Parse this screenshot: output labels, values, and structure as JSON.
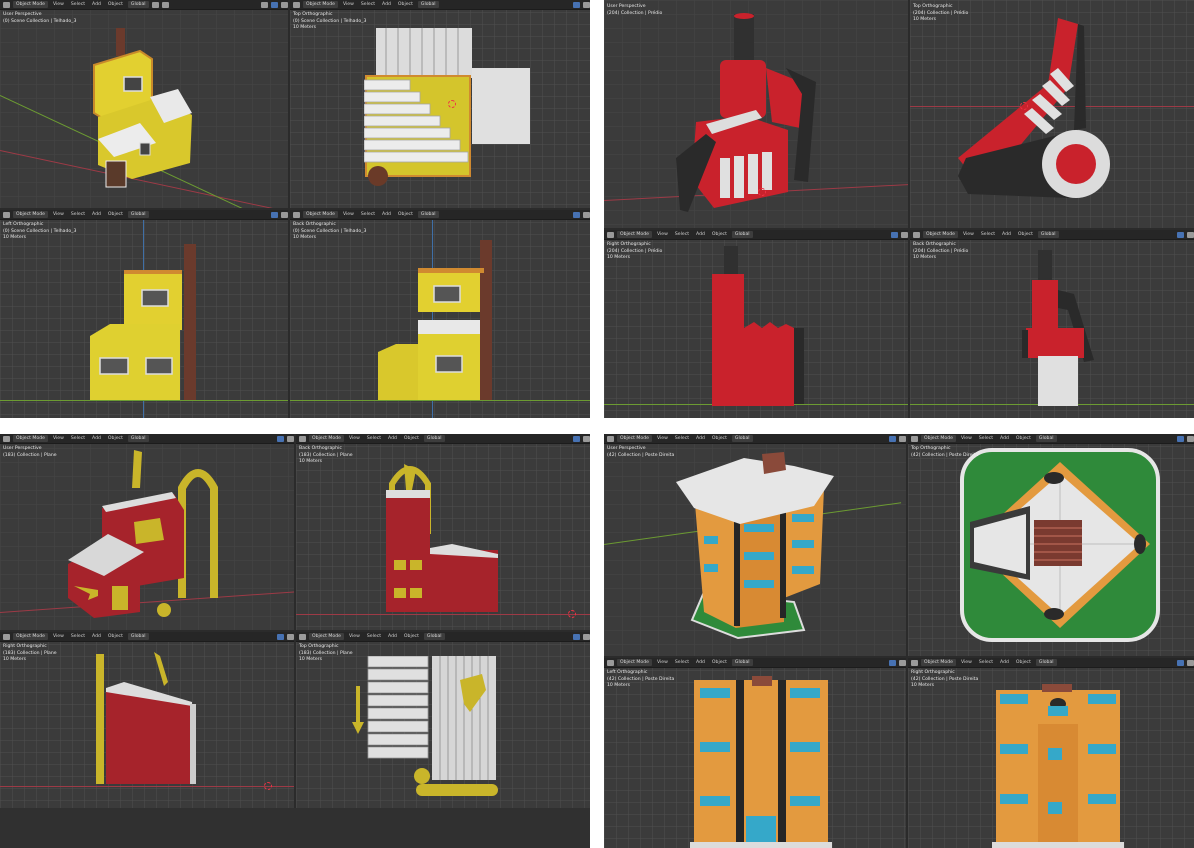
{
  "header": {
    "mode": "Object Mode",
    "menu": [
      "View",
      "Select",
      "Add",
      "Object"
    ],
    "orientation": "Global"
  },
  "scene_units": "10 Meters",
  "panels": [
    {
      "id": "tl",
      "viewports": [
        {
          "view": "User Perspective",
          "collection": "(0) Scene Collection | Telhado_3"
        },
        {
          "view": "Top Orthographic",
          "collection": "(0) Scene Collection | Telhado_3"
        },
        {
          "view": "Left Orthographic",
          "collection": "(0) Scene Collection | Telhado_3"
        },
        {
          "view": "Back Orthographic",
          "collection": "(0) Scene Collection | Telhado_3"
        }
      ]
    },
    {
      "id": "tr",
      "viewports": [
        {
          "view": "User Perspective",
          "collection": "(204) Collection | Prédio"
        },
        {
          "view": "Top Orthographic",
          "collection": "(204) Collection | Prédio"
        },
        {
          "view": "Right Orthographic",
          "collection": "(204) Collection | Prédio"
        },
        {
          "view": "Back Orthographic",
          "collection": "(204) Collection | Prédio"
        }
      ]
    },
    {
      "id": "bl",
      "viewports": [
        {
          "view": "User Perspective",
          "collection": "(183) Collection | Plane"
        },
        {
          "view": "Back Orthographic",
          "collection": "(183) Collection | Plane"
        },
        {
          "view": "Right Orthographic",
          "collection": "(183) Collection | Plane"
        },
        {
          "view": "Top Orthographic",
          "collection": "(183) Collection | Plane"
        }
      ]
    },
    {
      "id": "br",
      "viewports": [
        {
          "view": "User Perspective",
          "collection": "(42) Collection | Poste Direita"
        },
        {
          "view": "Top Orthographic",
          "collection": "(42) Collection | Poste Direita"
        },
        {
          "view": "Left Orthographic",
          "collection": "(42) Collection | Poste Direita"
        },
        {
          "view": "Right Orthographic",
          "collection": "(42) Collection | Poste Direita"
        }
      ]
    }
  ],
  "colors": {
    "viewport_bg": "#3b3b3b",
    "header_bg": "#262626",
    "x_axis": "#9d3a46",
    "y_axis": "#3f6fa6",
    "house_yellow": "#e8d733",
    "factory_red": "#c9222c",
    "barn_red": "#a6232b",
    "building_orange": "#e39a3f",
    "lawn_green": "#2f8a3a"
  }
}
